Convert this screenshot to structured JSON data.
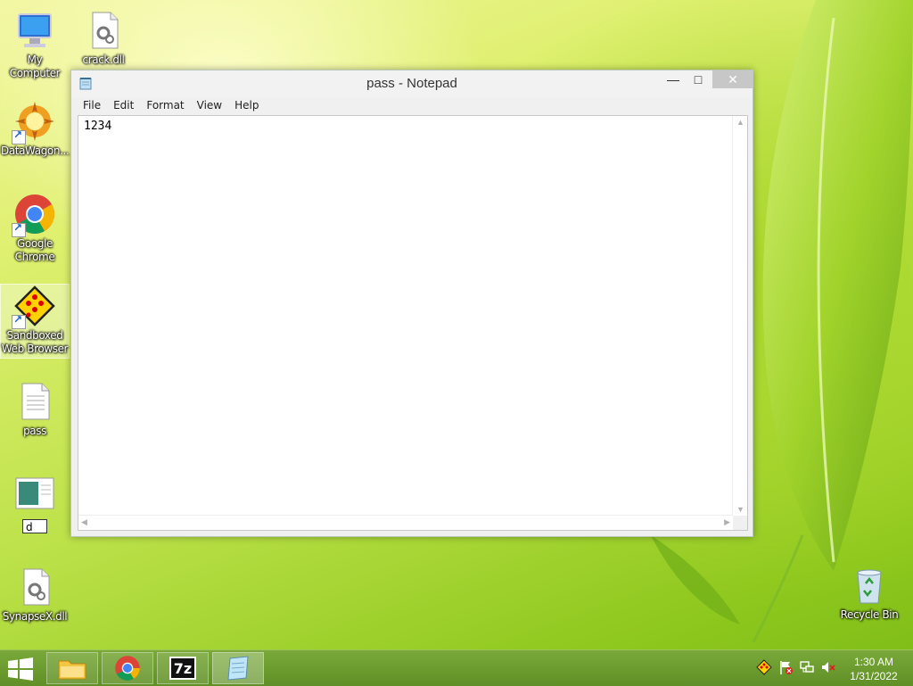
{
  "desktop": {
    "icons": [
      {
        "label": "My Computer"
      },
      {
        "label": "crack.dll"
      },
      {
        "label": "DataWagon..."
      },
      {
        "label": "Google Chrome"
      },
      {
        "label": "Sandboxed Web Browser"
      },
      {
        "label": "pass"
      },
      {
        "rename_value": "d"
      },
      {
        "label": "SynapseX.dll"
      },
      {
        "label": "Recycle Bin"
      }
    ]
  },
  "notepad": {
    "title": "pass - Notepad",
    "menu": [
      "File",
      "Edit",
      "Format",
      "View",
      "Help"
    ],
    "content": "1234"
  },
  "taskbar": {
    "time": "1:30 AM",
    "date": "1/31/2022"
  }
}
